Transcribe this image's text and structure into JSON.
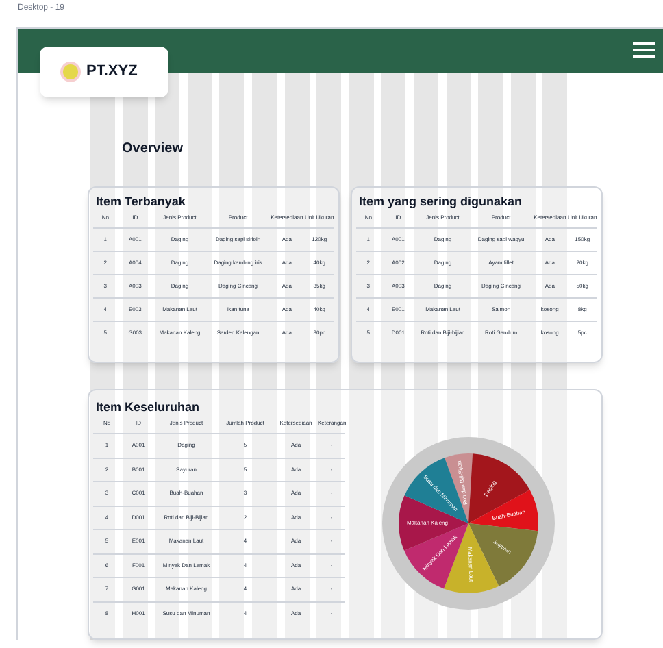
{
  "frame_label": "Desktop - 19",
  "header": {
    "brand": "PT.XYZ"
  },
  "section_title": "Overview",
  "top_tables": [
    {
      "title": "Item Terbanyak",
      "columns": [
        "No",
        "ID",
        "Jenis Product",
        "Product",
        "Ketersediaan",
        "Unit Ukuran"
      ],
      "rows": [
        [
          "1",
          "A001",
          "Daging",
          "Daging sapi sirloin",
          "Ada",
          "120kg"
        ],
        [
          "2",
          "A004",
          "Daging",
          "Daging kambing iris",
          "Ada",
          "40kg"
        ],
        [
          "3",
          "A003",
          "Daging",
          "Daging Cincang",
          "Ada",
          "35kg"
        ],
        [
          "4",
          "E003",
          "Makanan Laut",
          "Ikan tuna",
          "Ada",
          "40kg"
        ],
        [
          "5",
          "G003",
          "Makanan Kaleng",
          "Sarden Kalengan",
          "Ada",
          "30pc"
        ]
      ]
    },
    {
      "title": "Item yang sering digunakan",
      "columns": [
        "No",
        "ID",
        "Jenis Product",
        "Product",
        "Ketersediaan",
        "Unit Ukuran"
      ],
      "rows": [
        [
          "1",
          "A001",
          "Daging",
          "Daging sapi wagyu",
          "Ada",
          "150kg"
        ],
        [
          "2",
          "A002",
          "Daging",
          "Ayam fillet",
          "Ada",
          "20kg"
        ],
        [
          "3",
          "A003",
          "Daging",
          "Daging Cincang",
          "Ada",
          "50kg"
        ],
        [
          "4",
          "E001",
          "Makanan Laut",
          "Salmon",
          "kosong",
          "8kg"
        ],
        [
          "5",
          "D001",
          "Roti dan Biji-bijian",
          "Roti Gandum",
          "kosong",
          "5pc"
        ]
      ]
    }
  ],
  "overall": {
    "title": "Item Keseluruhan",
    "columns": [
      "No",
      "ID",
      "Jenis Product",
      "Jumlah Product",
      "Ketersediaan",
      "Keterangan"
    ],
    "rows": [
      [
        "1",
        "A001",
        "Daging",
        "5",
        "Ada",
        "-"
      ],
      [
        "2",
        "B001",
        "Sayuran",
        "5",
        "Ada",
        "-"
      ],
      [
        "3",
        "C001",
        "Buah-Buahan",
        "3",
        "Ada",
        "-"
      ],
      [
        "4",
        "D001",
        "Roti dan Biji-Bijian",
        "2",
        "Ada",
        "-"
      ],
      [
        "5",
        "E001",
        "Makanan Laut",
        "4",
        "Ada",
        "-"
      ],
      [
        "6",
        "F001",
        "Minyak Dan Lemak",
        "4",
        "Ada",
        "-"
      ],
      [
        "7",
        "G001",
        "Makanan Kaleng",
        "4",
        "Ada",
        "-"
      ],
      [
        "8",
        "H001",
        "Susu dan Minuman",
        "4",
        "Ada",
        "-"
      ]
    ],
    "chart_data": {
      "type": "pie",
      "categories": [
        "Roti dan Biji-Bijian",
        "Daging",
        "Buah-Buahan",
        "Sayuran",
        "Makanan Laut",
        "Minyak Dan Lemak",
        "Makanan Kaleng",
        "Susu dan Minuman"
      ],
      "values": [
        6.5,
        16.1,
        9.7,
        16.1,
        12.9,
        12.9,
        12.9,
        12.9
      ],
      "colors": [
        "#c98f92",
        "#a3161c",
        "#e0121a",
        "#7f7a3a",
        "#c8b22a",
        "#c02a6e",
        "#a8174a",
        "#1f7f95"
      ]
    }
  }
}
